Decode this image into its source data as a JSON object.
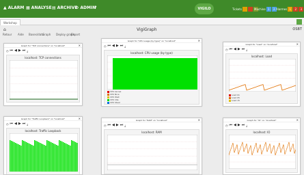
{
  "nav": {
    "alarm": "ALARM",
    "analyse": "ANALYSE",
    "archive": "ARCHIVE",
    "admin": "ADMIN"
  },
  "logo": "VIGILO",
  "status": {
    "tickets_label": "Tickets",
    "tickets_colors": [
      "#e0a000",
      "#d04020",
      "#7a9a2a"
    ],
    "machine_label": "Machine",
    "machine_values": [
      "1",
      "2"
    ],
    "machine_colors": [
      "#4aa0e0",
      "#4aa0e0"
    ],
    "alarms_label": "Alarmes",
    "alarms_values": [
      "1",
      "2",
      "3"
    ],
    "alarms_colors": [
      "#e0a000",
      "#d04020",
      "#d04020"
    ]
  },
  "tabs": {
    "current": "Workshop"
  },
  "page": {
    "title": "VigiGraph",
    "right": "OSBT"
  },
  "toolbar": {
    "items": [
      "Retour",
      "Aide",
      "Bases/data",
      "Graph",
      "Deploy graph",
      "Export"
    ]
  },
  "panels": [
    {
      "header": "Graph for \"TCP connections\" on \"localhost\"",
      "graph_title": "localhost: TCP connections",
      "colors": {
        "bg": "#f4f4f4",
        "series": "#2c7a2c"
      },
      "legend": [
        "TCP connections 00.00 00.00 00.00"
      ]
    },
    {
      "header": "Graph for \"CPU usage (by type)\" on \"localhost\"",
      "graph_title": "localhost: CPU usage (by type)",
      "colors": {
        "bg": "#f4f4f4",
        "series": "#00e000"
      },
      "legend": [
        "CPU kernel",
        "CPU Nice",
        "CPU Wait",
        "CPU Idle",
        "CPU Steal",
        "CPU Interr"
      ]
    },
    {
      "header": "Graph for \"Load\" on \"localhost\"",
      "graph_title": "localhost: Load",
      "colors": {
        "bg": "#f4f4f4",
        "series": "#e07000"
      },
      "legend": [
        "Load 01",
        "Load 05",
        "Load 15"
      ]
    },
    {
      "header": "Graph for \"Traffic Loopback\" on \"localhost\"",
      "graph_title": "localhost: Traffic Loopback",
      "colors": {
        "bg": "#f4f4f4",
        "series": "#00e000"
      },
      "legend": []
    },
    {
      "header": "Graph for \"RAM\" on \"localhost\"",
      "graph_title": "localhost: RAM",
      "colors": {
        "bg": "#f4f4f4",
        "series": "#c0c0c0"
      },
      "legend": []
    },
    {
      "header": "Graph for \"IO\" on \"localhost\"",
      "graph_title": "localhost: IO",
      "colors": {
        "bg": "#f4f4f4",
        "series": "#e07000"
      },
      "legend": []
    }
  ],
  "timerange": "Du: 'Jun 20 2018 10:49:50' au 'Jun 21 2018 10:49:50'"
}
